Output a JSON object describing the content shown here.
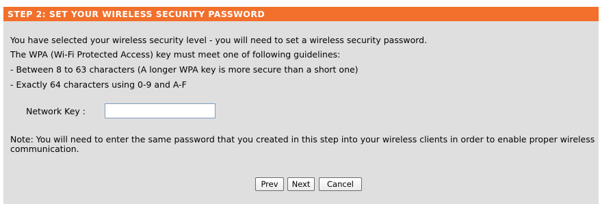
{
  "header": {
    "title": "STEP 2: SET YOUR WIRELESS SECURITY PASSWORD"
  },
  "intro": {
    "line1": "You have selected your wireless security level - you will need to set a wireless security password.",
    "line2": "The WPA (Wi-Fi Protected Access) key must meet one of following guidelines:",
    "line3": "- Between 8 to 63 characters (A longer WPA key is more secure than a short one)",
    "line4": "- Exactly 64 characters using 0-9 and A-F"
  },
  "network_key": {
    "label": "Network Key :",
    "value": "",
    "placeholder": ""
  },
  "note": {
    "text": "Note: You will need to enter the same password that you created in this step into your wireless clients in order to enable proper wireless communication."
  },
  "buttons": {
    "prev": "Prev",
    "next": "Next",
    "cancel": "Cancel"
  },
  "colors": {
    "header_bg": "#f26f2c",
    "panel_bg": "#dfdfdf",
    "header_text": "#ffffff"
  }
}
